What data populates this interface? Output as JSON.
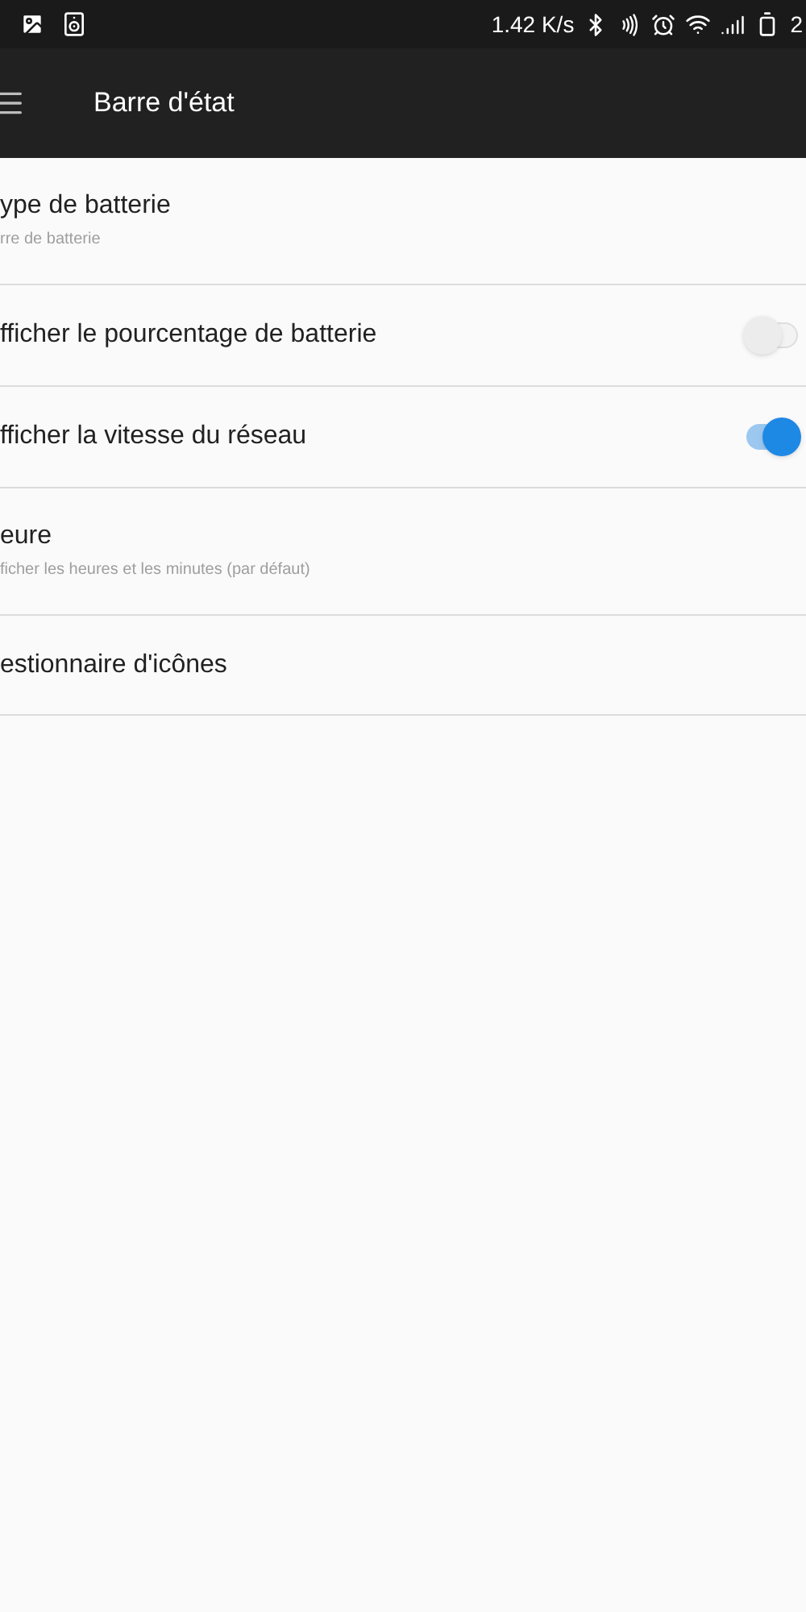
{
  "status_bar": {
    "speed": "1.42 K/s",
    "time": "2"
  },
  "toolbar": {
    "title": "Barre d'état"
  },
  "rows": [
    {
      "kind": "plain",
      "title": "ype de batterie",
      "subtitle": "rre de batterie"
    },
    {
      "kind": "toggle",
      "title": "fficher le pourcentage de batterie",
      "on": false
    },
    {
      "kind": "toggle",
      "title": "fficher la vitesse du réseau",
      "on": true
    },
    {
      "kind": "plain",
      "title": "eure",
      "subtitle": "ficher les heures et les minutes (par défaut)"
    },
    {
      "kind": "plain",
      "title": "estionnaire d'icônes"
    }
  ]
}
